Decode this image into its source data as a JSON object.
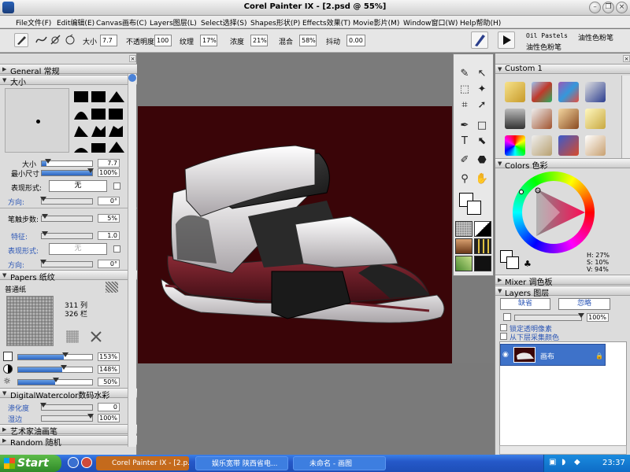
{
  "window": {
    "title": "Corel Painter IX - [2.psd @ 55%]"
  },
  "menu": [
    "File文件(F)",
    "Edit编辑(E)",
    "Canvas画布(C)",
    "Layers图层(L)",
    "Select选择(S)",
    "Shapes形状(P)",
    "Effects效果(T)",
    "Movie影片(M)",
    "Window窗口(W)",
    "Help帮助(H)"
  ],
  "propbar": {
    "size_label": "大小",
    "size_value": "7.7",
    "opacity_label": "不透明度",
    "opacity_value": "100",
    "grain_label": "纹理",
    "grain_value": "17%",
    "resat_label": "浓度",
    "resat_value": "21%",
    "bleed_label": "混合",
    "bleed_value": "58%",
    "jitter_label": "抖动",
    "jitter_value": "0.00",
    "brush_category": "Oil Pastels",
    "brush_category_cn": "油性色粉笔",
    "brush_variant_cn": "油性色粉笔"
  },
  "left_panel": {
    "general": "General 常规",
    "size_section": "大小",
    "size_label": "大小",
    "size_value": "7.7",
    "min_size_label": "最小尺寸",
    "min_size_value": "100%",
    "expression_label": "表现形式:",
    "expression_value": "无",
    "direction_label": "方向:",
    "direction_value": "0°",
    "stroke_label": "笔触步数:",
    "stroke_value": "5%",
    "feature_label": "特征:",
    "feature_value": "1.0",
    "expression2_label": "表现形式:",
    "expression2_value": "无",
    "direction2_label": "方向:",
    "direction2_value": "0°",
    "papers_section": "Papers 纸纹",
    "paper_name": "普通纸",
    "paper_cols": "311 列",
    "paper_rows": "326 栏",
    "paper_scale_value": "153%",
    "paper_contrast_value": "148%",
    "paper_brightness_value": "50%",
    "dw_section": "DigitalWatercolor数码水彩",
    "diffusion_label": "渗化度",
    "diffusion_value": "0",
    "wet_edge_label": "湿边",
    "wet_edge_value": "100%",
    "artist_oils": "艺术家油画笔",
    "random": "Random 随机"
  },
  "right_panel": {
    "custom_section": "Custom  1",
    "colors_section": "Colors 色彩",
    "hsv": {
      "h": "H: 27%",
      "s": "S: 10%",
      "v": "V: 94%"
    },
    "mixer_section": "Mixer 调色板",
    "layers_section": "Layers 图层",
    "composite_method": "缺省",
    "composite_depth": "忽略",
    "layer_opacity": "100%",
    "preserve_transparency": "锁定透明像素",
    "pick_up_color": "从下层采集颜色",
    "layer_name": "画布"
  },
  "taskbar": {
    "start": "Start",
    "items": [
      "Corel Painter IX - [2.p...",
      "娱乐宽带 陕西省电...",
      "未命名 - 画图"
    ],
    "clock": "23:37"
  },
  "colors": {
    "canvas_bg": "#3a0508",
    "accent_blue": "#2b64c0",
    "selection": "#3e72c9"
  }
}
